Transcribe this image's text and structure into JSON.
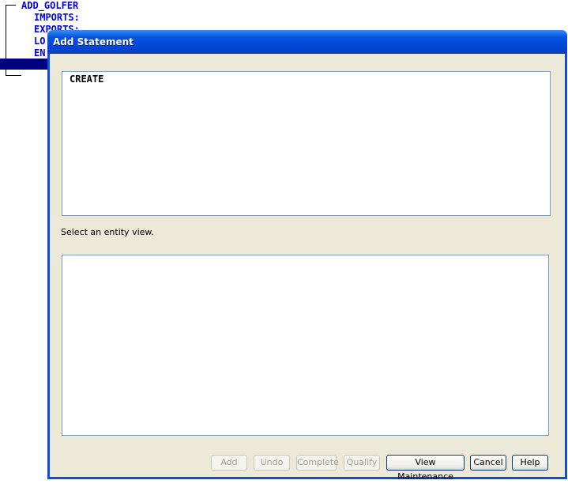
{
  "background": {
    "tree_lines": [
      "ADD_GOLFER",
      "IMPORTS:",
      "EXPORTS:",
      "LO",
      "EN"
    ],
    "selection_color": "#000080",
    "text_color": "#0000e0"
  },
  "dialog": {
    "title": "Add Statement",
    "statement_text": "CREATE",
    "prompt_label": "Select an entity view.",
    "buttons": [
      {
        "label": "Add",
        "enabled": false
      },
      {
        "label": "Undo",
        "enabled": false
      },
      {
        "label": "Complete",
        "enabled": false
      },
      {
        "label": "Qualify",
        "enabled": false
      },
      {
        "label": "View Maintenance",
        "enabled": true
      },
      {
        "label": "Cancel",
        "enabled": true
      },
      {
        "label": "Help",
        "enabled": true
      }
    ]
  }
}
